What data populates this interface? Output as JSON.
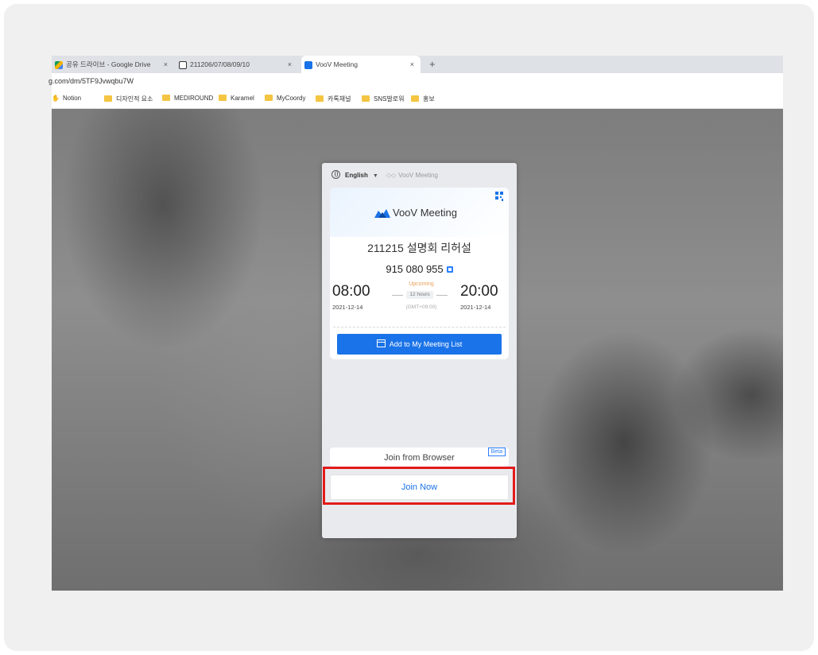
{
  "tabs": [
    {
      "label": "공유 드라이브 - Google Drive"
    },
    {
      "label": "211206/07/08/09/10"
    },
    {
      "label": "VooV Meeting"
    }
  ],
  "new_tab_label": "+",
  "close_glyph": "×",
  "url": "g.com/dm/5TF9Jvwqbu7W",
  "bookmarks": [
    {
      "label": "Notion"
    },
    {
      "label": "디자인적 요소"
    },
    {
      "label": "MEDIROUND"
    },
    {
      "label": "Karamel"
    },
    {
      "label": "MyCoordy"
    },
    {
      "label": "카톡채널"
    },
    {
      "label": "SNS발로워"
    },
    {
      "label": "홍보"
    }
  ],
  "meeting": {
    "language": "English",
    "header_brand": "VooV Meeting",
    "logo_text": "VooV Meeting",
    "title": "211215 설명회 리허설",
    "meeting_id": "915 080 955",
    "start_time": "08:00",
    "start_date": "2021-12-14",
    "end_time": "20:00",
    "end_date": "2021-12-14",
    "status": "Upcoming",
    "duration": "12 hours",
    "timezone": "(GMT+09:00)",
    "add_button": "Add to My Meeting List",
    "join_browser": "Join from Browser",
    "beta_badge": "Beta",
    "join_now": "Join Now"
  },
  "colors": {
    "accent": "#1a73e8",
    "highlight": "#e21b1b",
    "status": "#e9a15a"
  }
}
